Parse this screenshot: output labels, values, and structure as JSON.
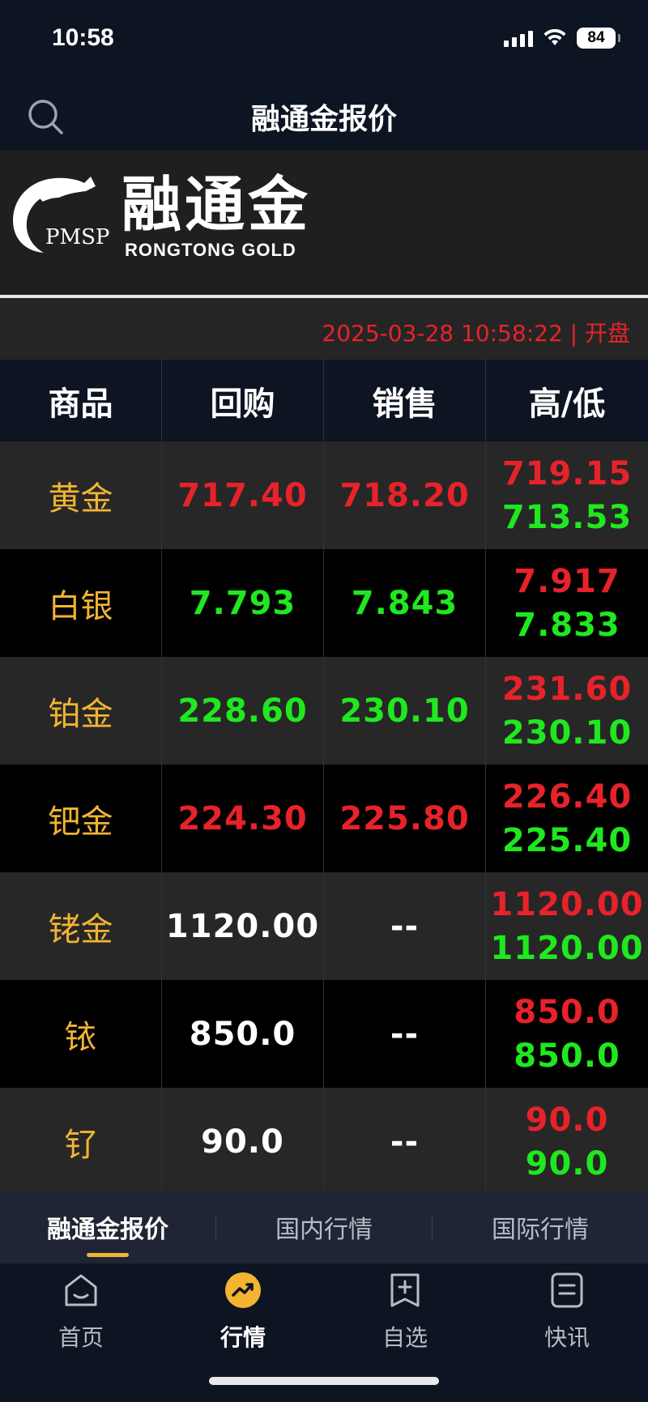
{
  "status_bar": {
    "time": "10:58",
    "battery": "84"
  },
  "header": {
    "title": "融通金报价"
  },
  "banner": {
    "logo_cn": "融通金",
    "logo_en": "RONGTONG GOLD",
    "logo_pmsp": "PMSP"
  },
  "timestamp": "2025-03-28 10:58:22 | 开盘",
  "colors": {
    "up": "#e8222a",
    "down": "#1fe81f",
    "neutral": "#ffffff",
    "name": "#f2b431",
    "accent": "#f2b431"
  },
  "table": {
    "headers": [
      "商品",
      "回购",
      "销售",
      "高/低"
    ],
    "rows": [
      {
        "name": "黄金",
        "buy": "717.40",
        "buy_color": "red",
        "sell": "718.20",
        "sell_color": "red",
        "high": "719.15",
        "low": "713.53"
      },
      {
        "name": "白银",
        "buy": "7.793",
        "buy_color": "green",
        "sell": "7.843",
        "sell_color": "green",
        "high": "7.917",
        "low": "7.833"
      },
      {
        "name": "铂金",
        "buy": "228.60",
        "buy_color": "green",
        "sell": "230.10",
        "sell_color": "green",
        "high": "231.60",
        "low": "230.10"
      },
      {
        "name": "钯金",
        "buy": "224.30",
        "buy_color": "red",
        "sell": "225.80",
        "sell_color": "red",
        "high": "226.40",
        "low": "225.40"
      },
      {
        "name": "铑金",
        "buy": "1120.00",
        "buy_color": "white",
        "sell": "--",
        "sell_color": "white",
        "high": "1120.00",
        "low": "1120.00"
      },
      {
        "name": "铱",
        "buy": "850.0",
        "buy_color": "white",
        "sell": "--",
        "sell_color": "white",
        "high": "850.0",
        "low": "850.0"
      },
      {
        "name": "钌",
        "buy": "90.0",
        "buy_color": "white",
        "sell": "--",
        "sell_color": "white",
        "high": "90.0",
        "low": "90.0"
      }
    ]
  },
  "sub_tabs": [
    "融通金报价",
    "国内行情",
    "国际行情"
  ],
  "bottom_nav": [
    {
      "label": "首页",
      "icon": "home-icon"
    },
    {
      "label": "行情",
      "icon": "market-trend-icon"
    },
    {
      "label": "自选",
      "icon": "add-watchlist-icon"
    },
    {
      "label": "快讯",
      "icon": "news-icon"
    }
  ]
}
